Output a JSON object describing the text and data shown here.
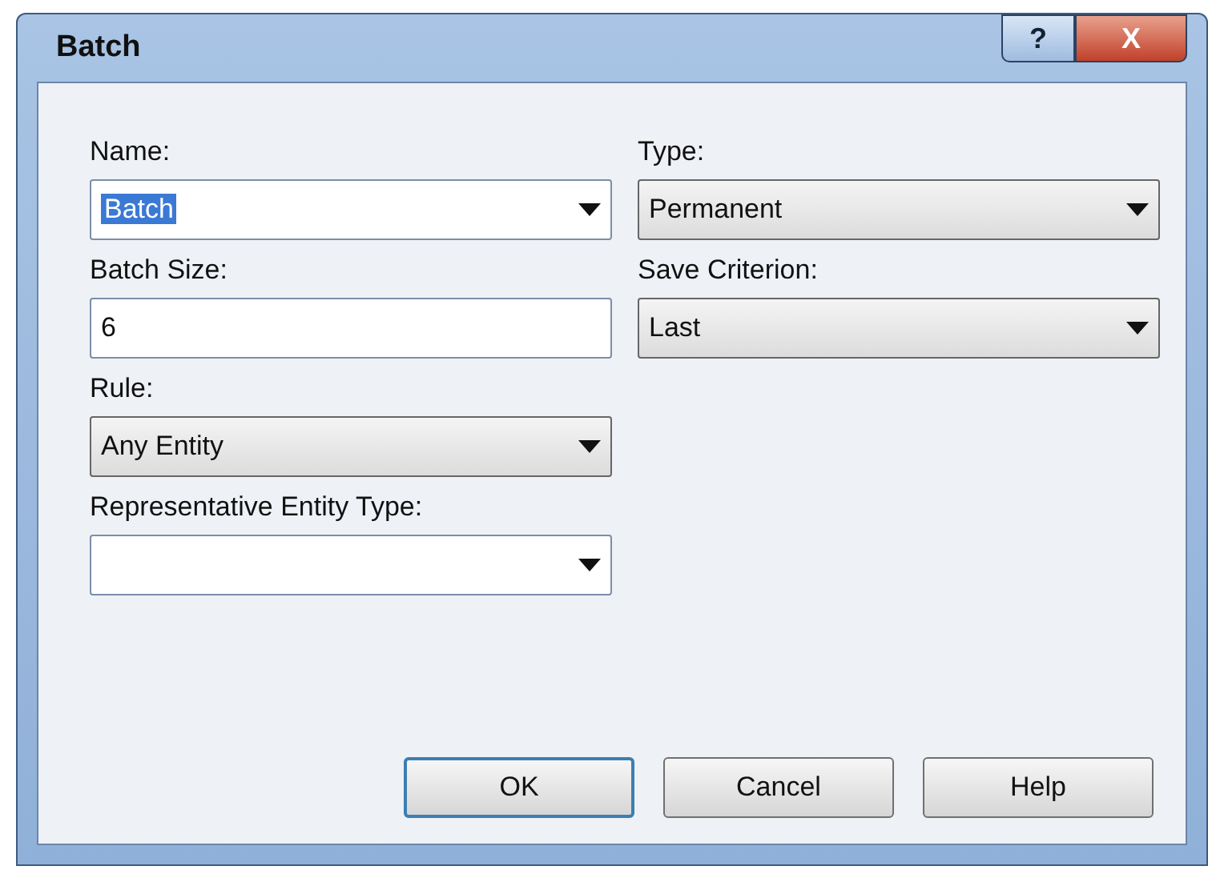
{
  "window": {
    "title": "Batch",
    "help_button": "?",
    "close_button": "X"
  },
  "columns": [
    {
      "fields": [
        {
          "label": "Name:",
          "kind": "combo",
          "value": "Batch",
          "text_selected": true
        },
        {
          "label": "Batch Size:",
          "kind": "text",
          "value": "6",
          "text_selected": false
        },
        {
          "label": "Rule:",
          "kind": "list",
          "value": "Any Entity",
          "text_selected": false
        },
        {
          "label": "Representative Entity Type:",
          "kind": "combo",
          "text_selected": false
        }
      ]
    },
    {
      "fields": [
        {
          "label": "Type:",
          "kind": "list",
          "value": "Permanent",
          "text_selected": false
        },
        {
          "label": "Save Criterion:",
          "kind": "list",
          "value": "Last",
          "text_selected": false
        }
      ]
    }
  ],
  "buttons": [
    {
      "label": "OK",
      "default": true
    },
    {
      "label": "Cancel",
      "default": false
    },
    {
      "label": "Help",
      "default": false
    }
  ]
}
